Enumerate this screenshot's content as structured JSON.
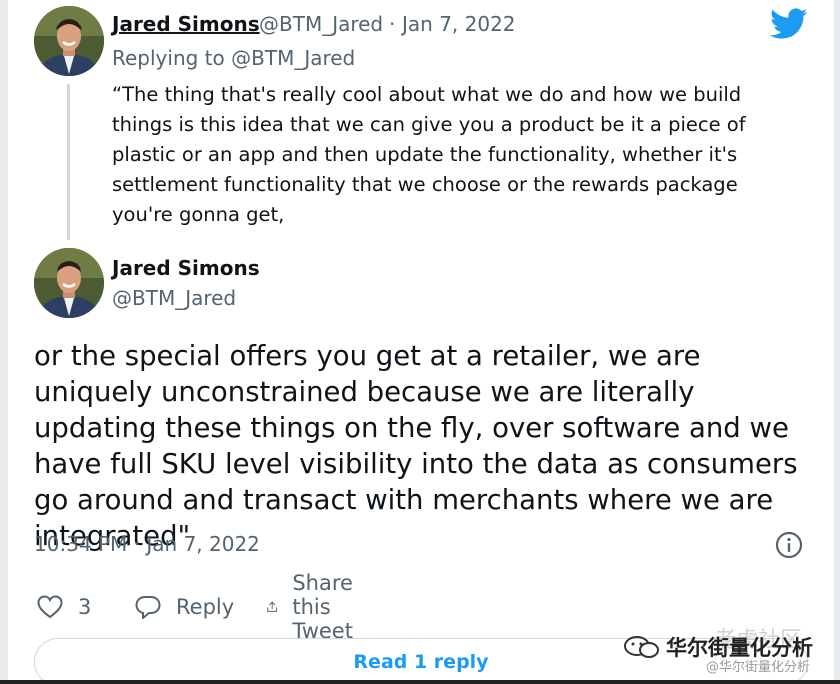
{
  "quoted_tweet": {
    "author_name": "Jared Simons",
    "handle": "@BTM_Jared",
    "separator": "·",
    "date": "Jan 7, 2022",
    "replying_prefix": "Replying to",
    "replying_to": "@BTM_Jared",
    "text": "“The thing that's really cool about what we do and how we build things is this idea that we can give you a product be it a piece of plastic or an app and then update the functionality, whether it's settlement functionality that we choose or the rewards package you're gonna get,"
  },
  "main_tweet": {
    "author_name": "Jared Simons",
    "handle": "@BTM_Jared",
    "text": "or the special offers you get at a retailer, we are uniquely unconstrained because we are literally updating these things on the fly, over software and we have full SKU level visibility into the data as consumers go around and transact with merchants where we are integrated\"",
    "timestamp": "10:34 PM · Jan 7, 2022"
  },
  "actions": {
    "like_count": "3",
    "reply_label": "Reply",
    "share_label": "Share this Tweet"
  },
  "read_reply_label": "Read 1 reply",
  "watermark": {
    "main": "华尔街量化分析",
    "ghost": "老虎社区",
    "sub": "@华尔街量化分析"
  },
  "colors": {
    "twitter_blue": "#1d9bf0",
    "text_primary": "#0f1419",
    "text_secondary": "#536471",
    "border": "#cfd9de"
  },
  "icons": [
    "twitter-bird-icon",
    "info-icon",
    "heart-icon",
    "reply-bubble-icon",
    "share-icon",
    "wechat-icon"
  ]
}
